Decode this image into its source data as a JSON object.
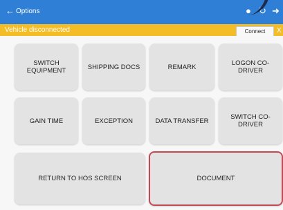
{
  "topbar": {
    "title": "Options"
  },
  "status": {
    "text": "Vehicle disconnected",
    "connect_label": "Connect",
    "close": "X"
  },
  "buttons": {
    "switch_equipment": "SWITCH EQUIPMENT",
    "shipping_docs": "SHIPPING DOCS",
    "remark": "REMARK",
    "logon_codriver": "LOGON CO-DRIVER",
    "gain_time": "GAIN TIME",
    "exception": "EXCEPTION",
    "data_transfer": "DATA TRANSFER",
    "switch_codriver": "SWITCH CO-DRIVER",
    "return_hos": "RETURN TO HOS SCREEN",
    "document": "DOCUMENT"
  },
  "colors": {
    "topbar": "#2f7fd6",
    "statusbar": "#f4bd25",
    "selected_border": "#c24a54"
  },
  "icons": [
    "back-arrow-icon",
    "user-icon",
    "refresh-icon",
    "logout-icon"
  ]
}
